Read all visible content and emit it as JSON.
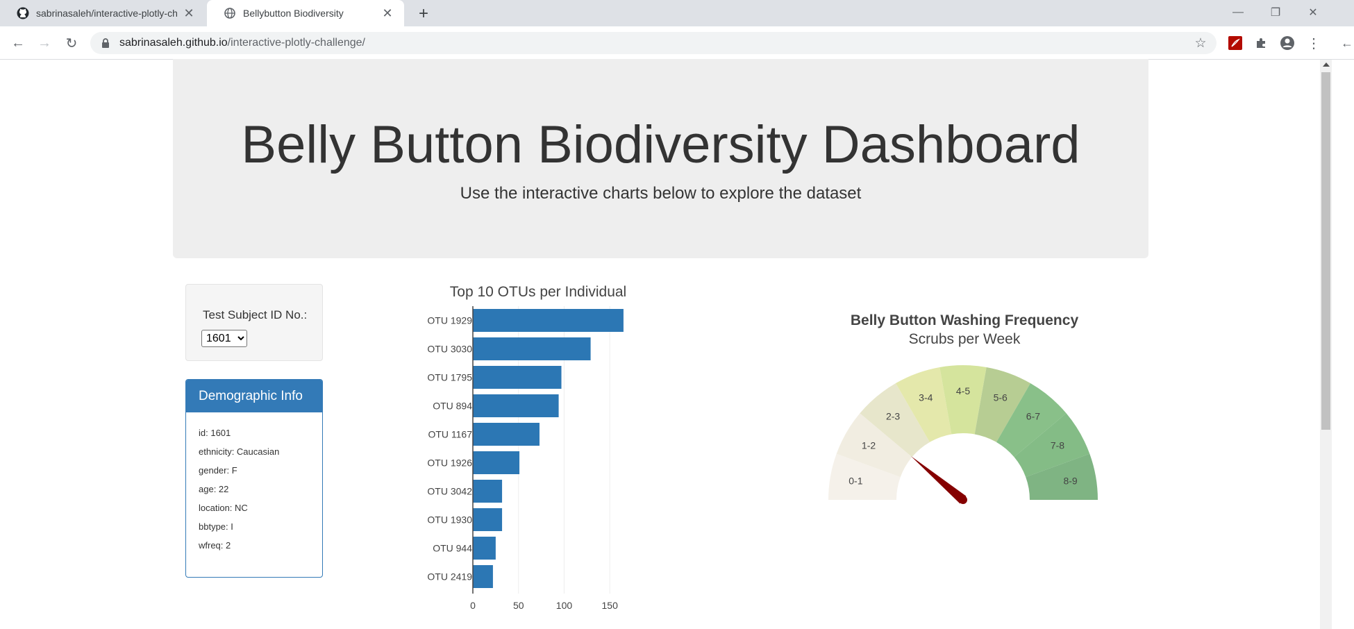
{
  "browser": {
    "tabs": [
      {
        "title": "sabrinasaleh/interactive-plotly-ch",
        "icon": "github-icon"
      },
      {
        "title": "Bellybutton Biodiversity",
        "icon": "globe-icon"
      }
    ],
    "url_host": "sabrinasaleh.github.io",
    "url_path": "/interactive-plotly-challenge/"
  },
  "header": {
    "title": "Belly Button Biodiversity Dashboard",
    "subtitle": "Use the interactive charts below to explore the dataset"
  },
  "selector": {
    "label": "Test Subject ID No.:",
    "selected": "1601"
  },
  "demographics": {
    "title": "Demographic Info",
    "rows": [
      "id: 1601",
      "ethnicity: Caucasian",
      "gender: F",
      "age: 22",
      "location: NC",
      "bbtype: I",
      "wfreq: 2"
    ]
  },
  "chart_data": [
    {
      "type": "bar",
      "orientation": "horizontal",
      "title": "Top 10 OTUs per Individual",
      "categories": [
        "OTU 1929",
        "OTU 3030",
        "OTU 1795",
        "OTU 894",
        "OTU 1167",
        "OTU 1926",
        "OTU 3042",
        "OTU 1930",
        "OTU 944",
        "OTU 2419"
      ],
      "values": [
        165,
        129,
        97,
        94,
        73,
        51,
        32,
        32,
        25,
        22
      ],
      "xlim": [
        0,
        170
      ],
      "xticks": [
        0,
        50,
        100,
        150
      ],
      "color": "#2c77b4",
      "grid": true
    },
    {
      "type": "gauge",
      "title": "Belly Button Washing Frequency",
      "subtitle": "Scrubs per Week",
      "range": [
        0,
        9
      ],
      "segments": [
        "0-1",
        "1-2",
        "2-3",
        "3-4",
        "4-5",
        "5-6",
        "6-7",
        "7-8",
        "8-9"
      ],
      "segment_colors": [
        "#f5f1ea",
        "#f1ede1",
        "#e7e6cb",
        "#e4e8ab",
        "#d5e49d",
        "#b7cd93",
        "#89c089",
        "#84bc86",
        "#7fb483"
      ],
      "value": 2,
      "needle_color": "#850000"
    }
  ]
}
